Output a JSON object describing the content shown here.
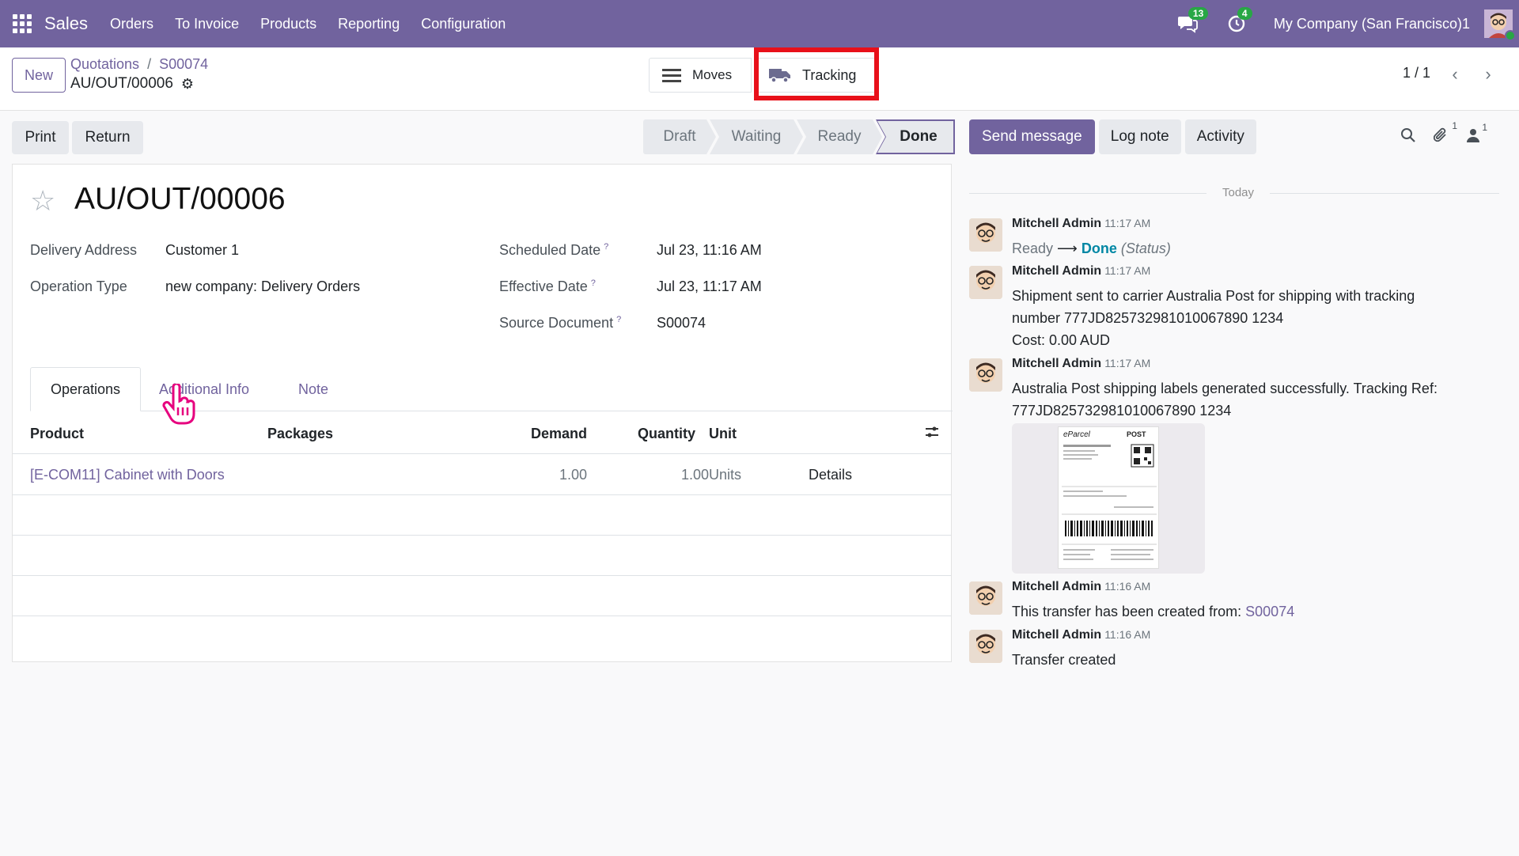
{
  "navbar": {
    "brand": "Sales",
    "menu": [
      "Orders",
      "To Invoice",
      "Products",
      "Reporting",
      "Configuration"
    ],
    "messages_badge": "13",
    "activities_badge": "4",
    "company": "My Company (San Francisco)1"
  },
  "control_panel": {
    "new_label": "New",
    "breadcrumb": [
      "Quotations",
      "S00074"
    ],
    "breadcrumb_sep": "/",
    "record_name": "AU/OUT/00006",
    "moves_label": "Moves",
    "tracking_label": "Tracking",
    "pager": "1 / 1"
  },
  "actions": {
    "print_label": "Print",
    "return_label": "Return"
  },
  "stages": [
    "Draft",
    "Waiting",
    "Ready",
    "Done"
  ],
  "stage_current": "Done",
  "chatter_buttons": {
    "send_message": "Send message",
    "log_note": "Log note",
    "activity": "Activity",
    "attachments_count": "1",
    "followers_count": "1"
  },
  "form": {
    "title": "AU/OUT/00006",
    "fields": {
      "delivery_address_label": "Delivery Address",
      "delivery_address": "Customer 1",
      "operation_type_label": "Operation Type",
      "operation_type": "new company: Delivery Orders",
      "scheduled_date_label": "Scheduled Date",
      "scheduled_date": "Jul 23, 11:16 AM",
      "effective_date_label": "Effective Date",
      "effective_date": "Jul 23, 11:17 AM",
      "source_document_label": "Source Document",
      "source_document": "S00074",
      "help_mark": "?"
    },
    "tabs": [
      "Operations",
      "Additional Info",
      "Note"
    ],
    "table": {
      "headers": [
        "Product",
        "Packages",
        "Demand",
        "Quantity",
        "Unit"
      ],
      "rows": [
        {
          "product": "[E-COM11] Cabinet with Doors",
          "packages": "",
          "demand": "1.00",
          "quantity": "1.00",
          "unit": "Units",
          "details": "Details"
        }
      ]
    }
  },
  "chatter": {
    "today_label": "Today",
    "messages": [
      {
        "author": "Mitchell Admin",
        "time": "11:17 AM",
        "from_status": "Ready",
        "arrow": "⟶",
        "to_status": "Done",
        "field": "(Status)"
      },
      {
        "author": "Mitchell Admin",
        "time": "11:17 AM",
        "line1": "Shipment sent to carrier Australia Post for shipping with tracking",
        "line2": "number 777JD825732981010067890 1234",
        "line3": "Cost: 0.00 AUD"
      },
      {
        "author": "Mitchell Admin",
        "time": "11:17 AM",
        "line1": "Australia Post shipping labels generated successfully. Tracking Ref:",
        "line2": "777JD825732981010067890 1234",
        "attachment_brand": "eParcel",
        "attachment_logo": "POST"
      },
      {
        "author": "Mitchell Admin",
        "time": "11:16 AM",
        "text": "This transfer has been created from:",
        "link": "S00074"
      },
      {
        "author": "Mitchell Admin",
        "time": "11:16 AM",
        "text": "Transfer created"
      }
    ]
  },
  "colors": {
    "brand": "#71639e",
    "highlight": "#e8101a",
    "done_status": "#0087a4",
    "badge": "#28a745"
  }
}
